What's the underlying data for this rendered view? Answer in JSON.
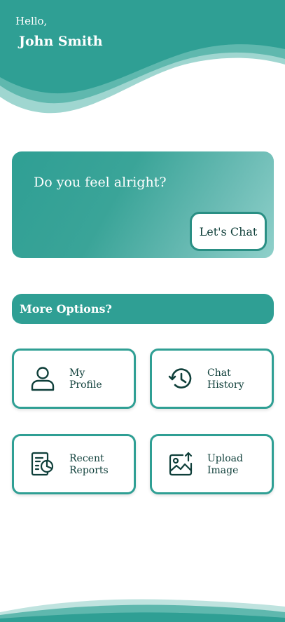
{
  "header": {
    "greeting": "Hello,",
    "user_name": "John Smith"
  },
  "chat_card": {
    "question": "Do you feel alright?",
    "button_label": "Let's Chat"
  },
  "options": {
    "title": "More Options?",
    "items": [
      {
        "line1": "My",
        "line2": "Profile",
        "icon": "user-icon"
      },
      {
        "line1": "Chat",
        "line2": "History",
        "icon": "history-icon"
      },
      {
        "line1": "Recent",
        "line2": "Reports",
        "icon": "report-icon"
      },
      {
        "line1": "Upload",
        "line2": "Image",
        "icon": "upload-image-icon"
      }
    ]
  },
  "colors": {
    "primary": "#2f9f94",
    "primary_dark": "#1e8479",
    "accent_light": "#8fd0ca",
    "text_dark": "#0f3f3a",
    "background": "#ffffff"
  }
}
